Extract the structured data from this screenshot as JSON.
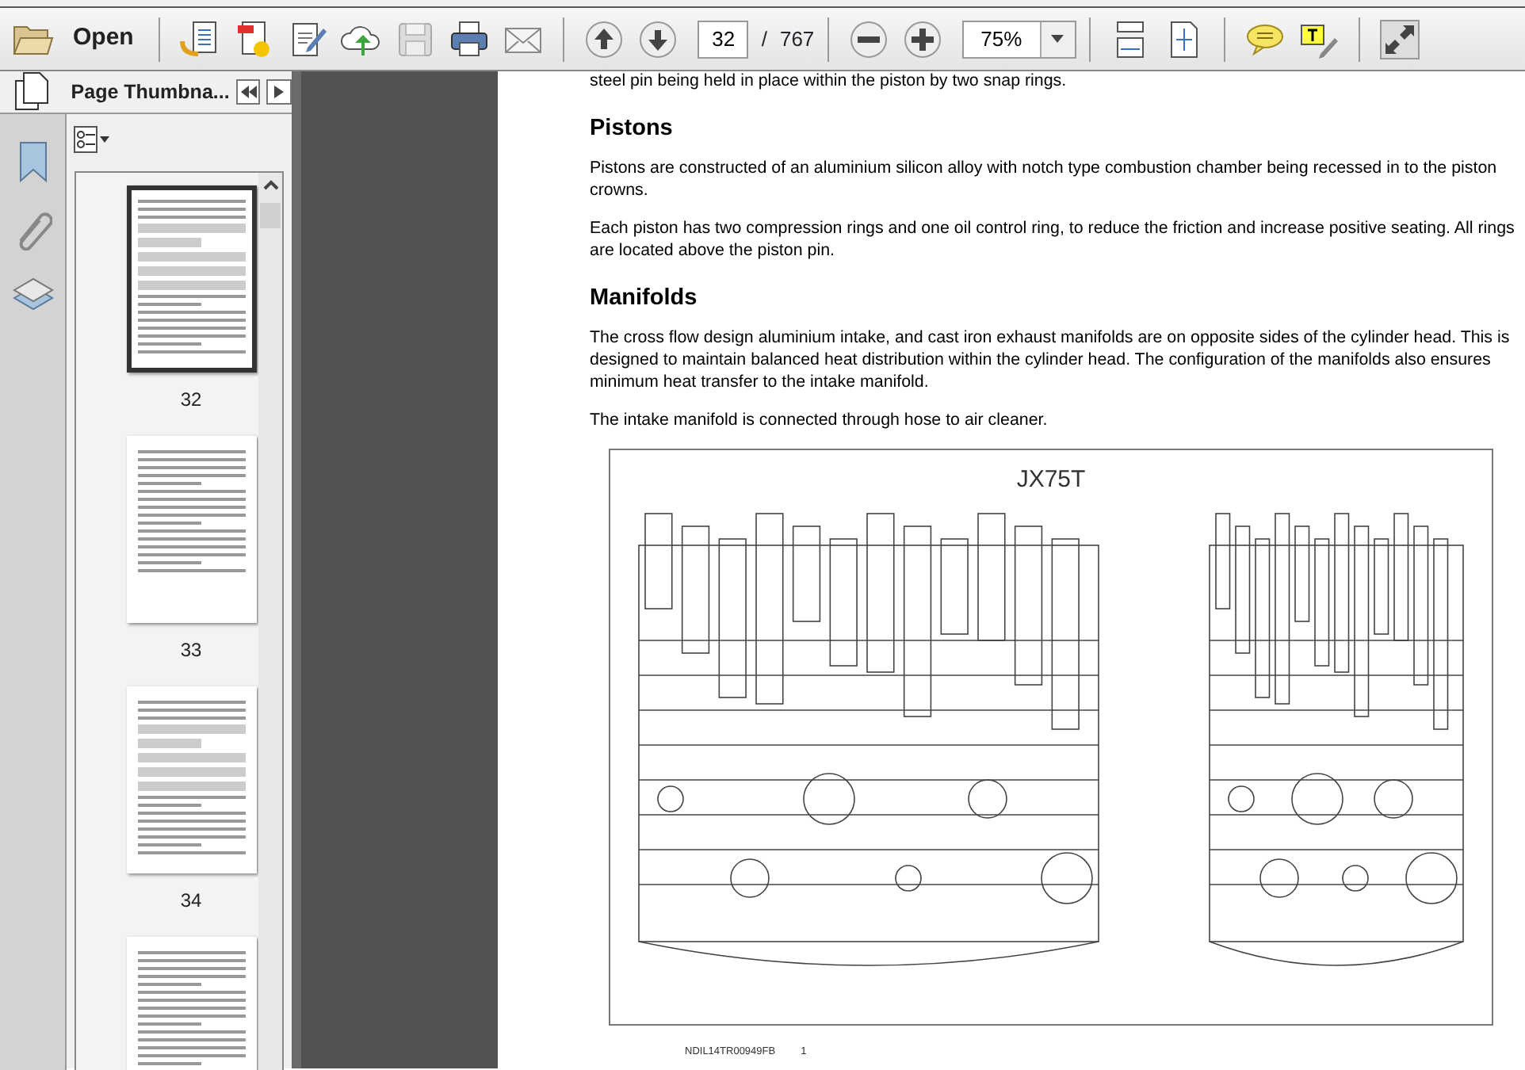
{
  "toolbar": {
    "open_label": "Open",
    "page_number": "32",
    "page_separator": "/",
    "page_total": "767",
    "zoom": "75%"
  },
  "sidebar": {
    "title": "Page Thumbna...",
    "thumbnails": [
      {
        "label": "32",
        "selected": true
      },
      {
        "label": "33",
        "selected": false
      },
      {
        "label": "34",
        "selected": false
      },
      {
        "selected": false
      }
    ]
  },
  "document": {
    "lead_text": "steel pin being held in place within the piston by two snap rings.",
    "sections": [
      {
        "heading": "Pistons",
        "paragraphs": [
          "Pistons are constructed of an aluminium silicon alloy with notch type combustion chamber being recessed in to the piston crowns.",
          "Each piston has two compression rings and one oil control ring, to reduce the friction and increase positive seating. All rings are located above the piston pin."
        ]
      },
      {
        "heading": "Manifolds",
        "paragraphs": [
          "The cross flow design aluminium intake, and cast iron exhaust manifolds are on opposite sides of the cylinder head. This is designed to maintain balanced heat distribution within the cylinder head.  The configuration of the manifolds also ensures minimum heat transfer to the intake manifold.",
          "The intake manifold is connected through hose to air cleaner."
        ]
      }
    ],
    "figure": {
      "title": "JX75T",
      "code": "NDIL14TR00949FB",
      "number": "1"
    }
  }
}
